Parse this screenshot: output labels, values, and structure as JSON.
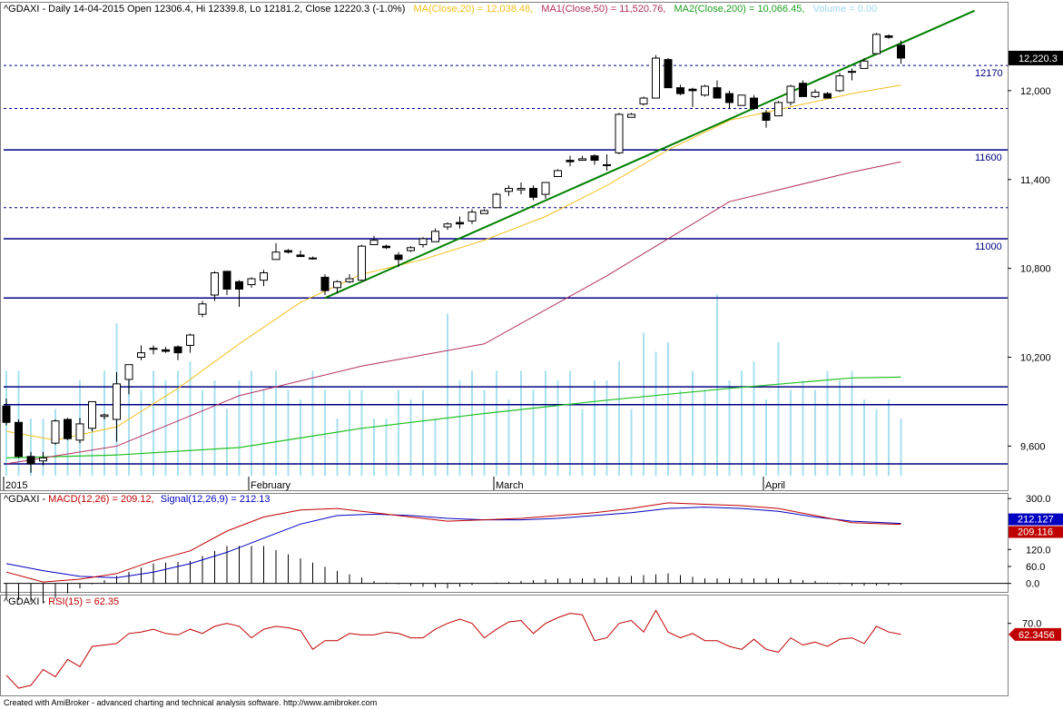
{
  "header": {
    "symbol": "^GDAXI",
    "text": "^GDAXI - Daily 14-04-2015 Open 12306.4, Hi 12339.8, Lo 12181.2, Close 12220.3 (-1.0%)",
    "ma20_label": "MA(Close,20) = 12,038.48,",
    "ma50_label": "MA1(Close,50) = 11,520.76,",
    "ma200_label": "MA2(Close,200) = 10,066.45,",
    "volume_label": "Volume = 0.00"
  },
  "macd_header": {
    "prefix": "^GDAXI - ",
    "macd_label": "MACD(12,26) = 209.12,",
    "signal_label": "Signal(12,26,9) = 212.13"
  },
  "rsi_header": {
    "prefix": "^GDAXI - ",
    "rsi_label": "RSI(15) = 62.35"
  },
  "footer": "Created with AmiBroker - advanced charting and technical analysis software. http://www.amibroker.com",
  "colors": {
    "ma20": "#f0c020",
    "ma50": "#b03060",
    "ma200": "#20c020",
    "volume": "#a8e0f0",
    "hline": "#000080",
    "trend": "#008000",
    "macd": "#c00000",
    "signal": "#0000c0",
    "rsi": "#c00000",
    "histogram": "#000000"
  },
  "chart_data": [
    {
      "type": "candlestick",
      "title": "^GDAXI Daily",
      "ylim": [
        9400,
        12600
      ],
      "y_ticks": [
        9600,
        10200,
        10800,
        11400,
        12000
      ],
      "y_tick_labels": [
        "9,600",
        "10,200",
        "10,800",
        "11,400",
        "12,000"
      ],
      "x_labels": [
        "2015",
        "February",
        "March",
        "April"
      ],
      "x_label_index": [
        0,
        20,
        40,
        62
      ],
      "last_price_label": "12,220.3",
      "last_price": 12220.3,
      "ohlc": [
        [
          9870,
          9920,
          9740,
          9760
        ],
        [
          9760,
          9780,
          9520,
          9530
        ],
        [
          9530,
          9560,
          9420,
          9480
        ],
        [
          9500,
          9560,
          9470,
          9520
        ],
        [
          9620,
          9780,
          9610,
          9770
        ],
        [
          9780,
          9790,
          9640,
          9650
        ],
        [
          9640,
          9790,
          9620,
          9750
        ],
        [
          9720,
          9900,
          9700,
          9900
        ],
        [
          9800,
          9820,
          9780,
          9810
        ],
        [
          9780,
          10100,
          9630,
          10020
        ],
        [
          10050,
          10150,
          9950,
          10150
        ],
        [
          10200,
          10280,
          10180,
          10230
        ],
        [
          10260,
          10280,
          10220,
          10260
        ],
        [
          10250,
          10270,
          10230,
          10240
        ],
        [
          10270,
          10280,
          10180,
          10230
        ],
        [
          10280,
          10360,
          10230,
          10350
        ],
        [
          10490,
          10580,
          10470,
          10560
        ],
        [
          10620,
          10780,
          10580,
          10770
        ],
        [
          10780,
          10780,
          10620,
          10660
        ],
        [
          10710,
          10720,
          10540,
          10660
        ],
        [
          10690,
          10740,
          10670,
          10730
        ],
        [
          10720,
          10790,
          10680,
          10770
        ],
        [
          10860,
          10970,
          10860,
          10910
        ],
        [
          10920,
          10930,
          10900,
          10910
        ],
        [
          10890,
          10920,
          10880,
          10880
        ],
        [
          10870,
          10880,
          10860,
          10870
        ],
        [
          10740,
          10760,
          10620,
          10650
        ],
        [
          10670,
          10720,
          10630,
          10710
        ],
        [
          10710,
          10760,
          10700,
          10730
        ],
        [
          10720,
          10960,
          10720,
          10950
        ],
        [
          10960,
          11020,
          10970,
          10990
        ],
        [
          10950,
          10960,
          10930,
          10940
        ],
        [
          10890,
          10910,
          10810,
          10860
        ],
        [
          10920,
          10950,
          10910,
          10940
        ],
        [
          10960,
          11010,
          10940,
          11000
        ],
        [
          10980,
          11070,
          10980,
          11050
        ],
        [
          11080,
          11110,
          11060,
          11100
        ],
        [
          11110,
          11150,
          11070,
          11100
        ],
        [
          11120,
          11200,
          11100,
          11180
        ],
        [
          11170,
          11200,
          11170,
          11190
        ],
        [
          11210,
          11310,
          11210,
          11300
        ],
        [
          11320,
          11360,
          11290,
          11340
        ],
        [
          11330,
          11380,
          11300,
          11340
        ],
        [
          11340,
          11360,
          11260,
          11280
        ],
        [
          11300,
          11380,
          11270,
          11380
        ],
        [
          11420,
          11470,
          11420,
          11460
        ],
        [
          11530,
          11560,
          11490,
          11520
        ],
        [
          11530,
          11560,
          11530,
          11540
        ],
        [
          11560,
          11570,
          11500,
          11530
        ],
        [
          11500,
          11570,
          11460,
          11500
        ],
        [
          11580,
          11850,
          11570,
          11840
        ],
        [
          11820,
          11850,
          11820,
          11840
        ],
        [
          11910,
          11960,
          11900,
          11950
        ],
        [
          11950,
          12240,
          11950,
          12220
        ],
        [
          12210,
          12220,
          12050,
          12020
        ],
        [
          12020,
          12040,
          11970,
          11980
        ],
        [
          12010,
          12020,
          11890,
          12000
        ],
        [
          11970,
          12040,
          11960,
          12030
        ],
        [
          12020,
          12070,
          11960,
          11950
        ],
        [
          11980,
          12000,
          11880,
          11920
        ],
        [
          11900,
          11970,
          11920,
          11970
        ],
        [
          11950,
          11970,
          11870,
          11880
        ],
        [
          11850,
          11870,
          11750,
          11800
        ],
        [
          11830,
          11930,
          11830,
          11920
        ],
        [
          11920,
          12040,
          11900,
          12030
        ],
        [
          12050,
          12070,
          11990,
          11960
        ],
        [
          11960,
          12010,
          11950,
          11990
        ],
        [
          11980,
          11990,
          11960,
          11950
        ],
        [
          12000,
          12120,
          11990,
          12100
        ],
        [
          12130,
          12150,
          12070,
          12130
        ],
        [
          12150,
          12220,
          12150,
          12200
        ],
        [
          12250,
          12390,
          12250,
          12380
        ],
        [
          12370,
          12380,
          12350,
          12360
        ],
        [
          12306.4,
          12339.8,
          12181.2,
          12220.3
        ]
      ],
      "volume_rel": [
        0.55,
        0.55,
        0.3,
        0.3,
        0.35,
        0.2,
        0.5,
        0.35,
        0.55,
        0.8,
        0.55,
        0.45,
        0.55,
        0.5,
        0.55,
        0.6,
        0.45,
        0.5,
        0.35,
        0.5,
        0.55,
        0.45,
        0.55,
        0.45,
        0.4,
        0.55,
        0.45,
        0.3,
        0.45,
        0.45,
        0.3,
        0.3,
        0.45,
        0.4,
        0.45,
        0.3,
        0.85,
        0.5,
        0.55,
        0.45,
        0.55,
        0.4,
        0.55,
        0.45,
        0.55,
        0.5,
        0.55,
        0.35,
        0.5,
        0.5,
        0.6,
        0.35,
        0.75,
        0.65,
        0.7,
        0.45,
        0.55,
        0.45,
        0.95,
        0.5,
        0.55,
        0.6,
        0.4,
        0.7,
        0.45,
        0.5,
        0.45,
        0.55,
        0.5,
        0.55,
        0.4,
        0.35,
        0.4,
        0.3
      ],
      "ma20": [
        [
          0,
          9700
        ],
        [
          4,
          9640
        ],
        [
          9,
          9730
        ],
        [
          14,
          9990
        ],
        [
          19,
          10290
        ],
        [
          24,
          10570
        ],
        [
          29,
          10760
        ],
        [
          34,
          10860
        ],
        [
          39,
          10990
        ],
        [
          44,
          11150
        ],
        [
          49,
          11360
        ],
        [
          54,
          11600
        ],
        [
          59,
          11800
        ],
        [
          64,
          11890
        ],
        [
          69,
          11980
        ],
        [
          73,
          12038
        ]
      ],
      "ma50": [
        [
          0,
          9480
        ],
        [
          9,
          9600
        ],
        [
          19,
          9940
        ],
        [
          29,
          10140
        ],
        [
          39,
          10290
        ],
        [
          49,
          10750
        ],
        [
          59,
          11250
        ],
        [
          69,
          11450
        ],
        [
          73,
          11520
        ]
      ],
      "ma200": [
        [
          0,
          9520
        ],
        [
          9,
          9540
        ],
        [
          19,
          9590
        ],
        [
          29,
          9720
        ],
        [
          39,
          9820
        ],
        [
          49,
          9910
        ],
        [
          59,
          9990
        ],
        [
          69,
          10060
        ],
        [
          73,
          10066
        ]
      ],
      "h_levels": [
        12170,
        11600,
        11000
      ],
      "h_level_labels": [
        "12170",
        "11600",
        "11000"
      ],
      "h_lines_unlabeled": [
        10600,
        10000,
        9880,
        9480
      ],
      "dashed_levels": [
        12170,
        11880,
        11210
      ],
      "trendline": [
        [
          26,
          10600
        ],
        [
          79,
          12540
        ]
      ]
    },
    {
      "type": "line",
      "title": "MACD(12,26) / Signal(12,26,9)",
      "ylim": [
        -30,
        320
      ],
      "y_ticks": [
        0,
        60,
        120,
        300
      ],
      "y_tick_labels": [
        "0.0",
        "60.0",
        "120.0",
        "300.0"
      ],
      "macd_value_label": "209.116",
      "signal_value_label": "212.127",
      "macd_value": 209.12,
      "signal_value": 212.13,
      "series": [
        {
          "name": "MACD(12,26)",
          "points": [
            [
              0,
              40
            ],
            [
              3,
              5
            ],
            [
              6,
              15
            ],
            [
              9,
              35
            ],
            [
              12,
              80
            ],
            [
              15,
              115
            ],
            [
              18,
              185
            ],
            [
              21,
              235
            ],
            [
              24,
              260
            ],
            [
              27,
              265
            ],
            [
              30,
              250
            ],
            [
              33,
              235
            ],
            [
              36,
              220
            ],
            [
              39,
              225
            ],
            [
              42,
              230
            ],
            [
              45,
              240
            ],
            [
              48,
              250
            ],
            [
              51,
              265
            ],
            [
              54,
              285
            ],
            [
              57,
              280
            ],
            [
              60,
              275
            ],
            [
              63,
              265
            ],
            [
              66,
              240
            ],
            [
              69,
              215
            ],
            [
              72,
              210
            ],
            [
              73,
              209
            ]
          ]
        },
        {
          "name": "Signal(12,26,9)",
          "points": [
            [
              0,
              70
            ],
            [
              3,
              45
            ],
            [
              6,
              25
            ],
            [
              9,
              20
            ],
            [
              12,
              40
            ],
            [
              15,
              70
            ],
            [
              18,
              110
            ],
            [
              21,
              160
            ],
            [
              24,
              210
            ],
            [
              27,
              240
            ],
            [
              30,
              245
            ],
            [
              33,
              240
            ],
            [
              36,
              230
            ],
            [
              39,
              225
            ],
            [
              42,
              225
            ],
            [
              45,
              230
            ],
            [
              48,
              240
            ],
            [
              51,
              250
            ],
            [
              54,
              265
            ],
            [
              57,
              270
            ],
            [
              60,
              265
            ],
            [
              63,
              255
            ],
            [
              66,
              235
            ],
            [
              69,
              220
            ],
            [
              72,
              214
            ],
            [
              73,
              212
            ]
          ]
        }
      ]
    },
    {
      "type": "line",
      "title": "RSI(15)",
      "ylim": [
        20,
        90
      ],
      "y_ticks": [
        70
      ],
      "y_tick_labels": [
        "70.0"
      ],
      "rsi_value_label": "62.3456",
      "series": [
        {
          "name": "RSI(15)",
          "values": [
            34,
            25,
            27,
            38,
            33,
            45,
            40,
            54,
            55,
            56,
            63,
            64,
            66,
            63,
            62,
            66,
            63,
            68,
            70,
            68,
            60,
            66,
            68,
            67,
            65,
            52,
            58,
            58,
            63,
            62,
            62,
            64,
            63,
            60,
            60,
            66,
            70,
            73,
            70,
            60,
            66,
            71,
            72,
            63,
            70,
            74,
            77,
            76,
            58,
            60,
            70,
            72,
            64,
            79,
            64,
            60,
            63,
            58,
            58,
            54,
            52,
            59,
            52,
            50,
            60,
            55,
            57,
            54,
            59,
            60,
            56,
            68,
            64,
            62.35
          ]
        }
      ]
    }
  ]
}
